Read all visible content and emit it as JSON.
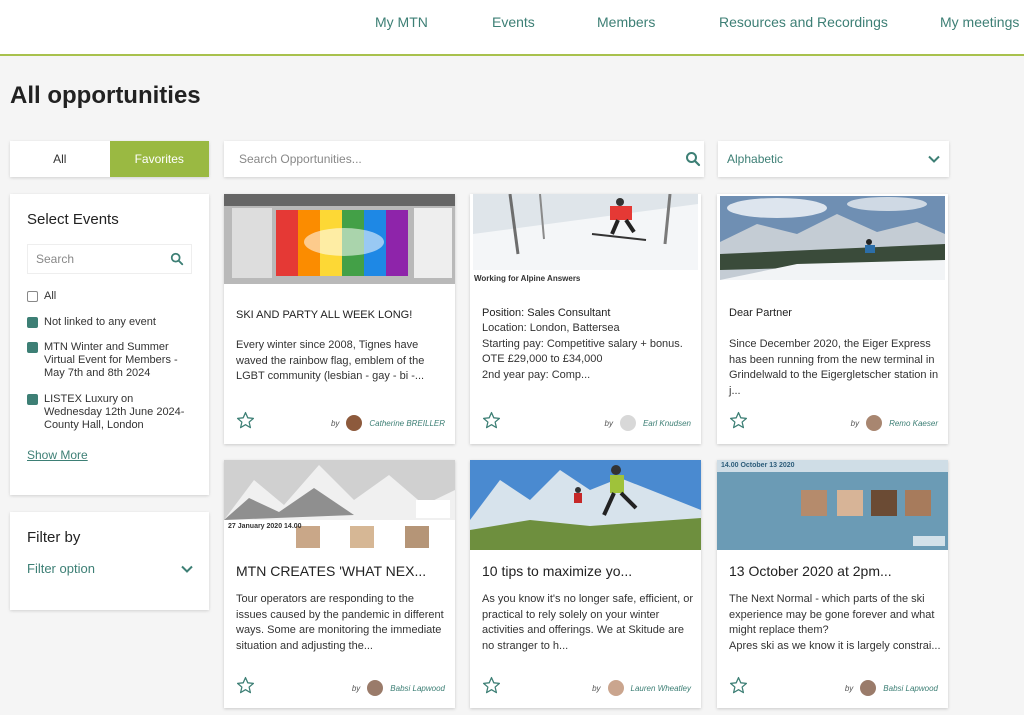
{
  "nav": [
    "My MTN",
    "Events",
    "Members",
    "Resources and Recordings",
    "My meetings"
  ],
  "page_title": "All opportunities",
  "toggle": {
    "all": "All",
    "favorites": "Favorites"
  },
  "search": {
    "placeholder": "Search Opportunities..."
  },
  "sort": {
    "value": "Alphabetic"
  },
  "events_panel": {
    "title": "Select Events",
    "search_placeholder": "Search",
    "options": [
      {
        "label": "All",
        "checked": false
      },
      {
        "label": "Not linked to any event",
        "checked": true
      },
      {
        "label": "MTN Winter and Summer Virtual Event for Members - May 7th and 8th 2024",
        "checked": true
      },
      {
        "label": "LISTEX Luxury on Wednesday 12th June 2024- County Hall, London",
        "checked": true
      }
    ],
    "show_more": "Show More"
  },
  "filter_panel": {
    "title": "Filter by",
    "option": "Filter option"
  },
  "cards": [
    {
      "title": "SKI AND PARTY ALL WEEK LONG!",
      "body": "Every winter since 2008, Tignes have waved the rainbow flag, emblem of the LGBT community (lesbian - gay - bi -...",
      "by": "by",
      "author": "Catherine BREILLER"
    },
    {
      "title": "Position: Sales Consultant",
      "body": "Location: London, Battersea\nStarting pay: Competitive salary + bonus. OTE £29,000 to £34,000\n2nd year pay: Comp...",
      "by": "by",
      "author": "Earl Knudsen",
      "image_label": "Working for Alpine Answers"
    },
    {
      "title": "Dear Partner",
      "body": "Since December 2020, the Eiger Express has been running from the new terminal in Grindelwald to the Eigergletscher station in j...",
      "by": "by",
      "author": "Remo Kaeser"
    },
    {
      "title": "MTN CREATES 'WHAT NEX...",
      "body": "Tour operators are responding to the issues caused by the pandemic in different ways. Some are monitoring the immediate situation and adjusting the...",
      "by": "by",
      "author": "Babsi Lapwood",
      "image_label": "27 January 2020 14.00"
    },
    {
      "title": "10 tips to maximize yo...",
      "body": "As you know it's no longer safe, efficient, or practical to rely solely on your winter activities and offerings. We at Skitude are no stranger to h...",
      "by": "by",
      "author": "Lauren Wheatley"
    },
    {
      "title": "13 October 2020 at 2pm...",
      "body": "The Next Normal - which parts of the ski experience may be gone forever and what might replace them?\nApres ski as we know it is largely constrai...",
      "by": "by",
      "author": "Babsi Lapwood",
      "image_label": "14.00 October 13 2020"
    }
  ],
  "colors": {
    "accent": "#3d7f75",
    "favorites": "#9ab942",
    "nav_line": "#a8c14d"
  }
}
